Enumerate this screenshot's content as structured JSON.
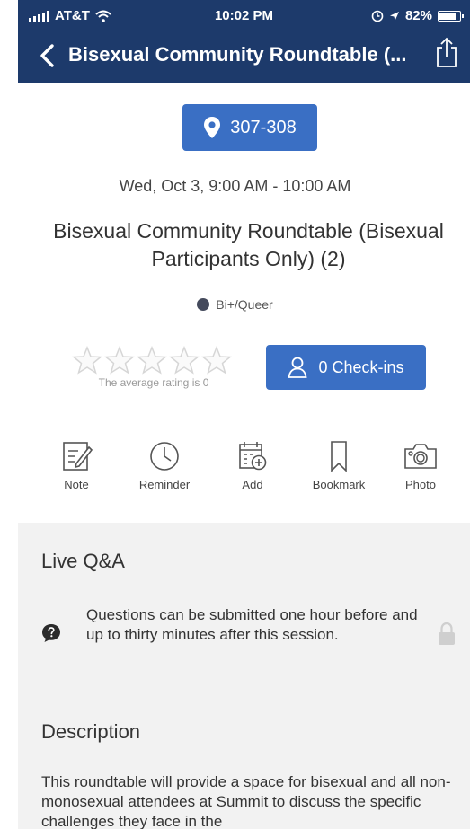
{
  "status_bar": {
    "carrier": "AT&T",
    "time": "10:02 PM",
    "battery": "82%"
  },
  "nav": {
    "title": "Bisexual Community Roundtable (..."
  },
  "session": {
    "location": "307-308",
    "datetime": "Wed, Oct 3, 9:00 AM - 10:00 AM",
    "title": "Bisexual Community Roundtable (Bisexual Participants Only) (2)",
    "tag": "Bi+/Queer"
  },
  "rating": {
    "stars_filled": 0,
    "stars_total": 5,
    "text": "The average rating is 0"
  },
  "checkins": {
    "label": "0 Check-ins"
  },
  "actions": [
    {
      "label": "Note"
    },
    {
      "label": "Reminder"
    },
    {
      "label": "Add"
    },
    {
      "label": "Bookmark"
    },
    {
      "label": "Photo"
    }
  ],
  "live_qa": {
    "heading": "Live Q&A",
    "text": "Questions can be submitted one hour before and up to thirty minutes after this session."
  },
  "description": {
    "heading": "Description",
    "text": "This roundtable will provide a space for bisexual and all non-monosexual attendees at Summit to discuss the specific challenges they face in the"
  },
  "colors": {
    "nav_bg": "#1d3a6b",
    "button_bg": "#3a6fc4",
    "tag_dot": "#444a5c",
    "section_bg": "#f2f2f2"
  }
}
